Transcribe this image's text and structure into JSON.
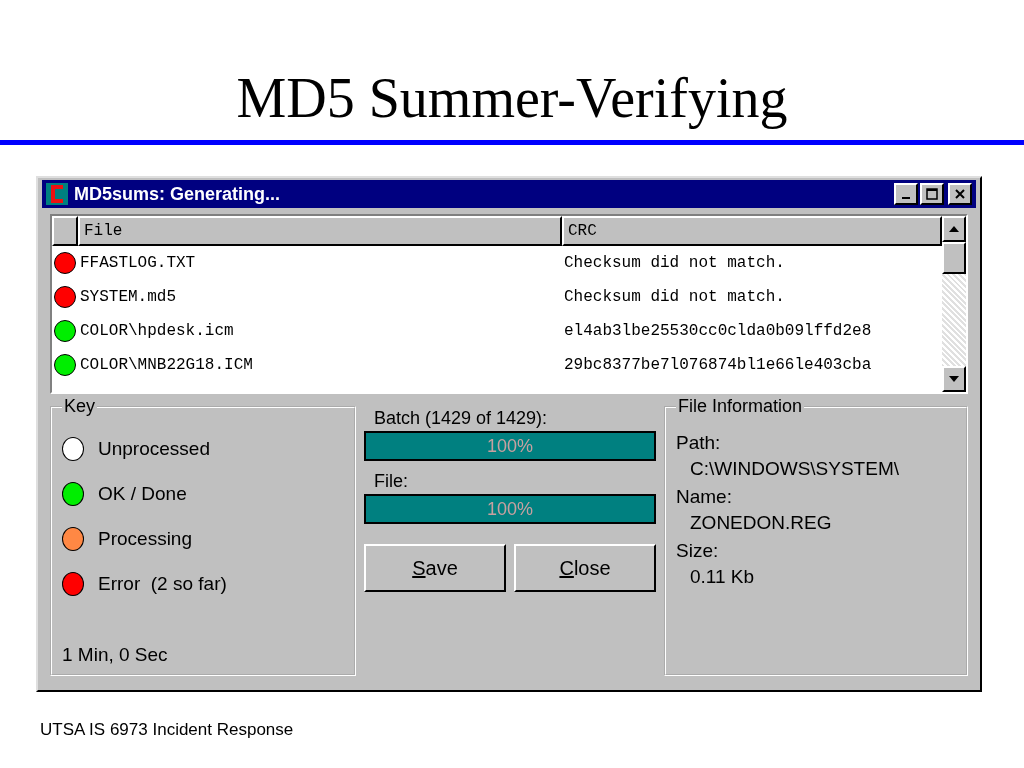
{
  "slide": {
    "title": "MD5 Summer-Verifying",
    "footer": "UTSA IS 6973 Incident Response"
  },
  "window": {
    "title": "MD5sums: Generating..."
  },
  "table": {
    "columns": [
      "File",
      "CRC"
    ],
    "rows": [
      {
        "file": "FFASTLOG.TXT",
        "crc": "Checksum did not match.",
        "color": "#ff0000"
      },
      {
        "file": "SYSTEM.md5",
        "crc": "Checksum did not match.",
        "color": "#ff0000"
      },
      {
        "file": "COLOR\\hpdesk.icm",
        "crc": "el4ab3lbe25530cc0clda0b09lffd2e8",
        "color": "#00ee00"
      },
      {
        "file": "COLOR\\MNB22G18.ICM",
        "crc": "29bc8377be7l076874bl1e66le403cba",
        "color": "#00ee00"
      }
    ]
  },
  "key": {
    "title": "Key",
    "items": [
      {
        "label": "Unprocessed",
        "color": "#ffffff"
      },
      {
        "label": "OK / Done",
        "color": "#00ee00"
      },
      {
        "label": "Processing",
        "color": "#ff8844"
      },
      {
        "label": "Error  (2 so far)",
        "color": "#ff0000"
      }
    ],
    "elapsed": "1 Min, 0 Sec"
  },
  "progress": [
    {
      "label": "Batch (1429 of 1429):",
      "level": 1,
      "reading": "100%"
    },
    {
      "label": "File:",
      "level": 1,
      "reading": "100%"
    }
  ],
  "buttons": [
    "Save",
    "Close"
  ],
  "file_info": {
    "title": "File Information",
    "fields": [
      {
        "label": "Path:",
        "value": "C:\\WINDOWS\\SYSTEM\\"
      },
      {
        "label": "Name:",
        "value": "ZONEDON.REG"
      },
      {
        "label": "Size:",
        "value": "0.11 Kb"
      }
    ]
  }
}
